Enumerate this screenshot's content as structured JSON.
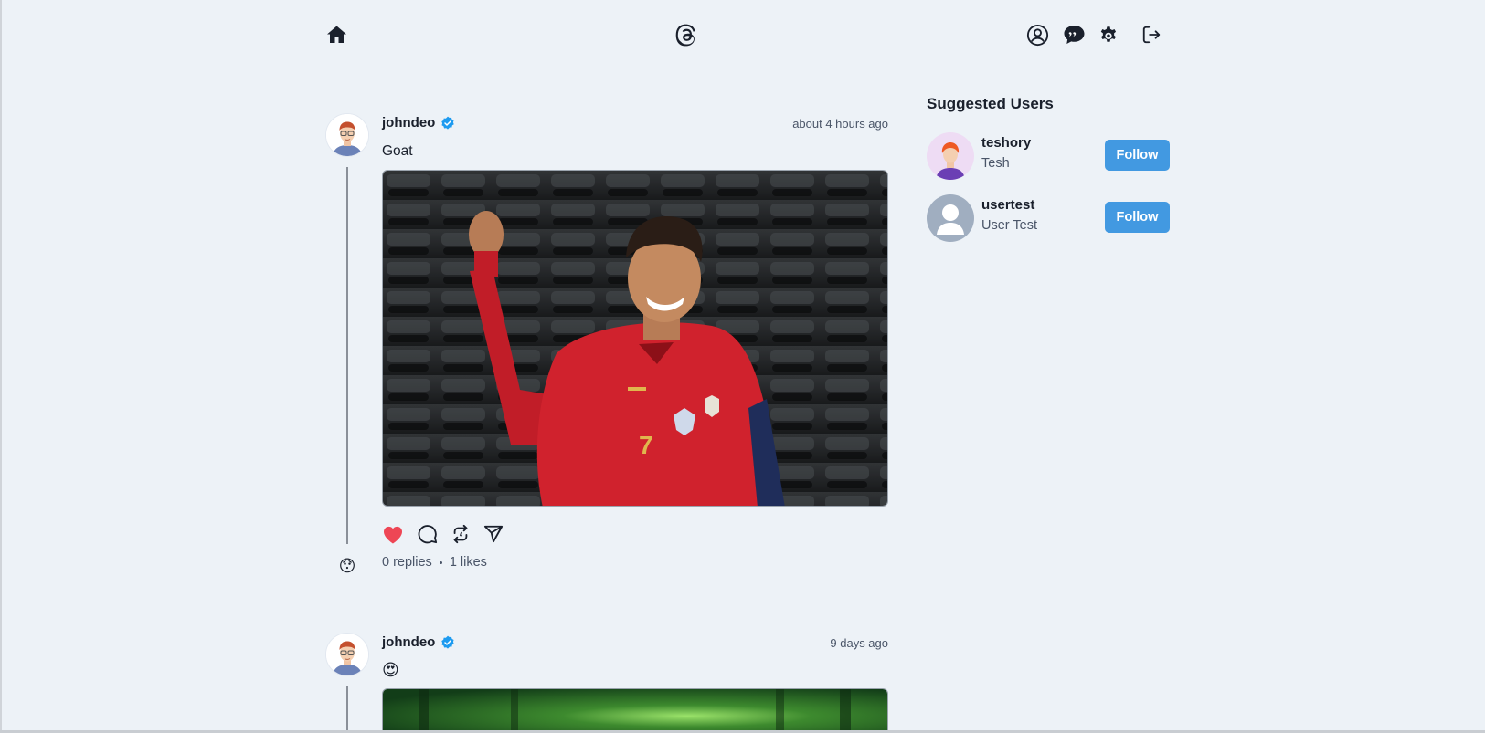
{
  "header": {
    "home_icon": "home-icon",
    "logo_icon": "threads-logo-icon",
    "profile_icon": "user-circle-icon",
    "chat_icon": "chat-bubble-icon",
    "settings_icon": "gear-icon",
    "logout_icon": "logout-icon"
  },
  "feed": {
    "posts": [
      {
        "username": "johndeo",
        "verified": true,
        "timestamp": "about 4 hours ago",
        "text": "Goat",
        "image_desc": "football-player-celebration",
        "liked": true,
        "replies_label": "0 replies",
        "likes_label": "1 likes",
        "reply_avatar_emoji": "😯"
      },
      {
        "username": "johndeo",
        "verified": true,
        "timestamp": "9 days ago",
        "text": "😍",
        "image_desc": "green-forest"
      }
    ]
  },
  "suggested": {
    "title": "Suggested Users",
    "users": [
      {
        "username": "teshory",
        "name": "Tesh",
        "follow_label": "Follow"
      },
      {
        "username": "usertest",
        "name": "User Test",
        "follow_label": "Follow"
      }
    ]
  },
  "colors": {
    "background": "#edf2f7",
    "follow_button": "#4299e1",
    "like_red": "#e53e3e",
    "verified_blue": "#1d9bf0"
  }
}
